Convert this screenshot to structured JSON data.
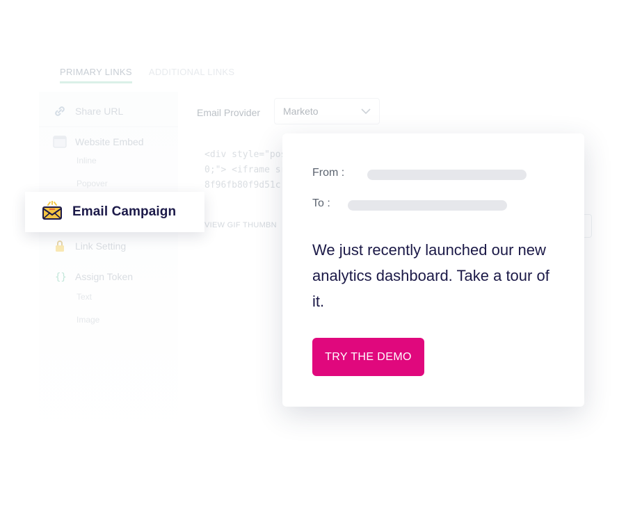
{
  "tabs": {
    "primary": "PRIMARY LINKS",
    "additional": "ADDITIONAL LINKS"
  },
  "sidebar": {
    "items": [
      {
        "label": "Share URL",
        "icon": "link-icon"
      },
      {
        "label": "Website Embed",
        "icon": "website-icon",
        "subitems": [
          "Inline",
          "Popover"
        ]
      },
      {
        "label": "Link Setting",
        "icon": "lock-icon"
      },
      {
        "label": "Assign Token",
        "icon": "braces-icon",
        "subitems": [
          "Text",
          "Image"
        ]
      }
    ]
  },
  "email_provider": {
    "label": "Email Provider",
    "selected": "Marketo"
  },
  "embed_code": {
    "lines": [
      "<div style=\"pos",
      "0;\"> <iframe src",
      "8f96fb80f9d51c"
    ]
  },
  "gif_thumbnail_link": "VIEW GIF THUMBN",
  "campaign_card": {
    "label": "Email Campaign",
    "icon": "envelope-icon"
  },
  "email_preview": {
    "from_label": "From :",
    "to_label": "To :",
    "body": "We just recently launched our new analytics dashboard. Take a tour of it.",
    "cta_label": "TRY THE DEMO"
  },
  "colors": {
    "cta": "#e0087d",
    "text_dark": "#1b1947",
    "tab_underline": "#a9dcc9"
  }
}
